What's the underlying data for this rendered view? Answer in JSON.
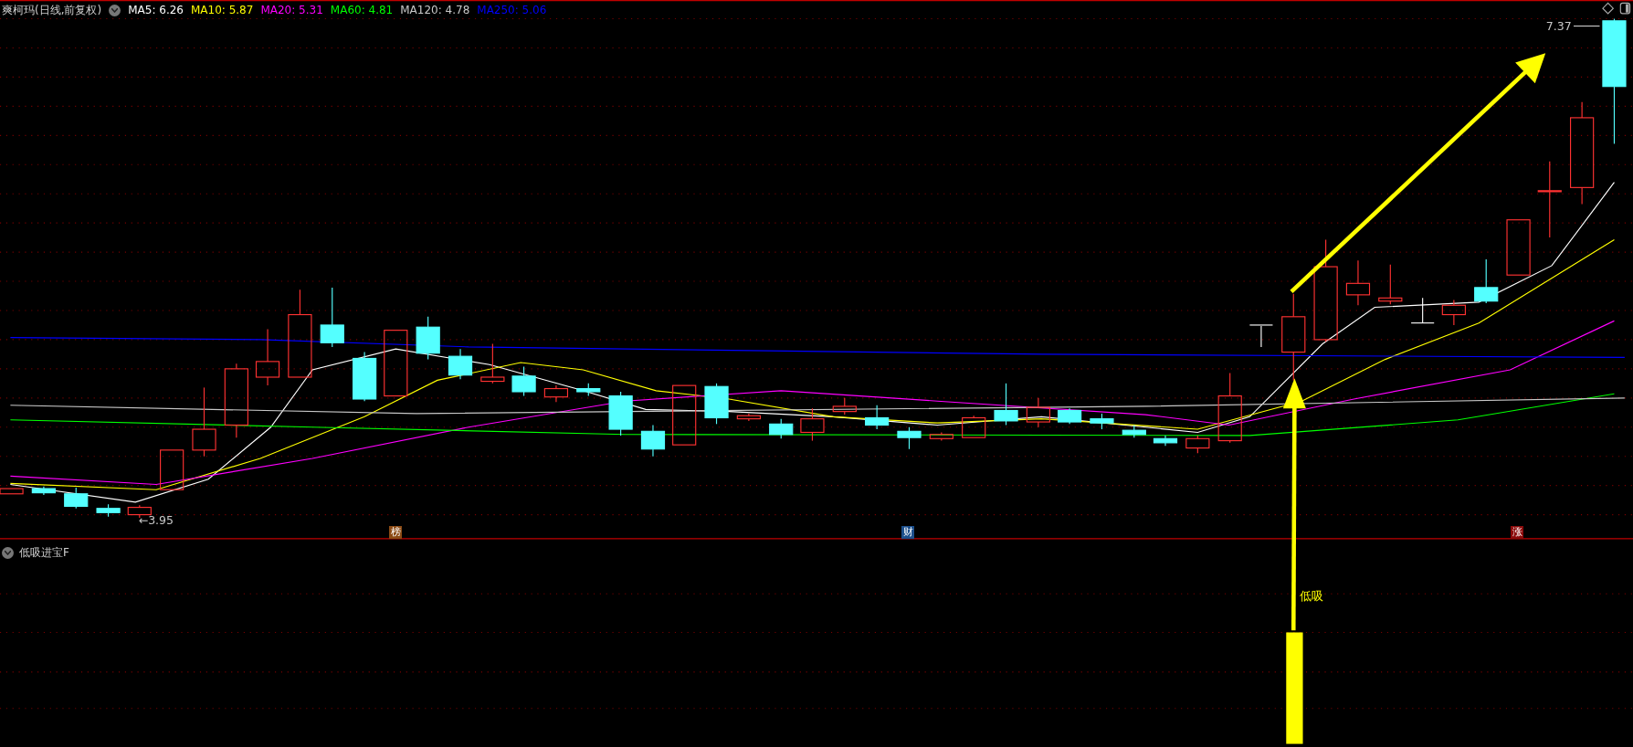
{
  "header": {
    "title": "爽柯玛(日线,前复权)",
    "ma": [
      {
        "label": "MA5: 6.26",
        "color": "#ffffff"
      },
      {
        "label": "MA10: 5.87",
        "color": "#ffff00"
      },
      {
        "label": "MA20: 5.31",
        "color": "#ff00ff"
      },
      {
        "label": "MA60: 4.81",
        "color": "#00ff00"
      },
      {
        "label": "MA120: 4.78",
        "color": "#c8c8c8"
      },
      {
        "label": "MA250: 5.06",
        "color": "#0000ff"
      }
    ]
  },
  "price_labels": {
    "high": "7.37",
    "low": "←3.95"
  },
  "markers": [
    {
      "text": "榜",
      "color": "#8b4a14"
    },
    {
      "text": "财",
      "color": "#1c4f8c"
    },
    {
      "text": "涨",
      "color": "#8b0a0a"
    }
  ],
  "indicator": {
    "title": "低吸进宝F",
    "signal_label": "低吸"
  }
}
